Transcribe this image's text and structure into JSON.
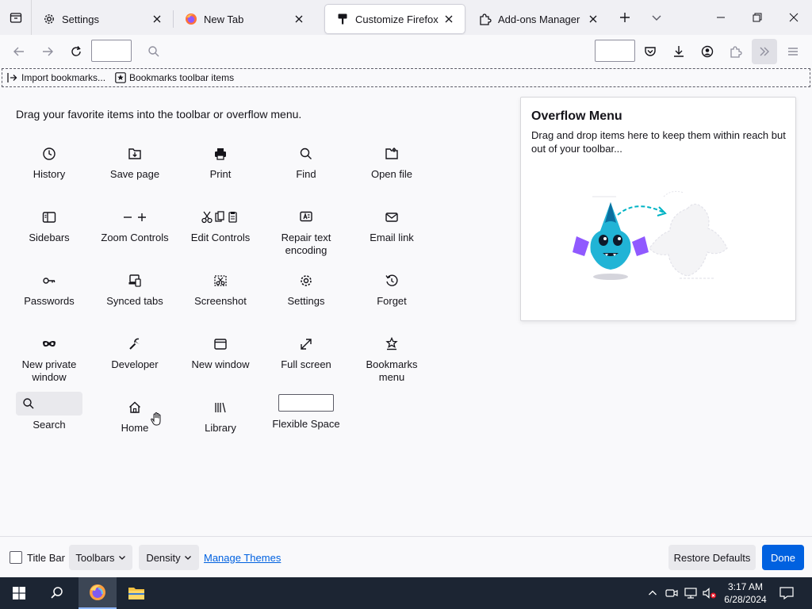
{
  "tabs": [
    {
      "label": "Settings",
      "icon": "gear-icon",
      "selected": false
    },
    {
      "label": "New Tab",
      "icon": "firefox-icon",
      "selected": false
    },
    {
      "label": "Customize Firefox",
      "icon": "paintbrush-icon",
      "selected": true
    },
    {
      "label": "Add-ons Manager",
      "icon": "puzzle-icon",
      "selected": false
    }
  ],
  "bookmarks_toolbar": {
    "items": [
      {
        "label": "Import bookmarks...",
        "icon": "import-icon"
      },
      {
        "label": "Bookmarks toolbar items",
        "icon": "star-icon"
      }
    ]
  },
  "palette": {
    "title": "Drag your favorite items into the toolbar or overflow menu.",
    "items": [
      {
        "label": "History",
        "icon": "clock-icon"
      },
      {
        "label": "Save page",
        "icon": "save-page-icon"
      },
      {
        "label": "Print",
        "icon": "printer-icon"
      },
      {
        "label": "Find",
        "icon": "search-icon"
      },
      {
        "label": "Open file",
        "icon": "folder-icon"
      },
      {
        "label": "Sidebars",
        "icon": "sidebar-icon"
      },
      {
        "label": "Zoom Controls",
        "icon": "zoom-icon"
      },
      {
        "label": "Edit Controls",
        "icon": "edit-controls-icon"
      },
      {
        "label": "Repair text encoding",
        "icon": "text-encoding-icon"
      },
      {
        "label": "Email link",
        "icon": "mail-icon"
      },
      {
        "label": "Passwords",
        "icon": "key-icon"
      },
      {
        "label": "Synced tabs",
        "icon": "synced-tabs-icon"
      },
      {
        "label": "Screenshot",
        "icon": "screenshot-icon"
      },
      {
        "label": "Settings",
        "icon": "gear-icon"
      },
      {
        "label": "Forget",
        "icon": "forget-icon"
      },
      {
        "label": "New private window",
        "icon": "mask-icon"
      },
      {
        "label": "Developer",
        "icon": "wrench-icon"
      },
      {
        "label": "New window",
        "icon": "window-icon"
      },
      {
        "label": "Full screen",
        "icon": "fullscreen-icon"
      },
      {
        "label": "Bookmarks menu",
        "icon": "bookmarks-menu-icon"
      },
      {
        "label": "Search",
        "icon": "search-icon"
      },
      {
        "label": "Home",
        "icon": "home-icon"
      },
      {
        "label": "Library",
        "icon": "library-icon"
      },
      {
        "label": "Flexible Space",
        "icon": "flexible-space"
      }
    ]
  },
  "overflow": {
    "title": "Overflow Menu",
    "text": "Drag and drop items here to keep them within reach but out of your toolbar..."
  },
  "footer": {
    "title_bar_label": "Title Bar",
    "title_bar_checked": false,
    "toolbars_label": "Toolbars",
    "density_label": "Density",
    "manage_themes_label": "Manage Themes",
    "restore_label": "Restore Defaults",
    "done_label": "Done"
  },
  "taskbar": {
    "time": "3:17 AM",
    "date": "6/28/2024"
  },
  "colors": {
    "accent": "#0061e0",
    "taskbar": "#1c2533",
    "tabbar": "#f0f0f4"
  }
}
